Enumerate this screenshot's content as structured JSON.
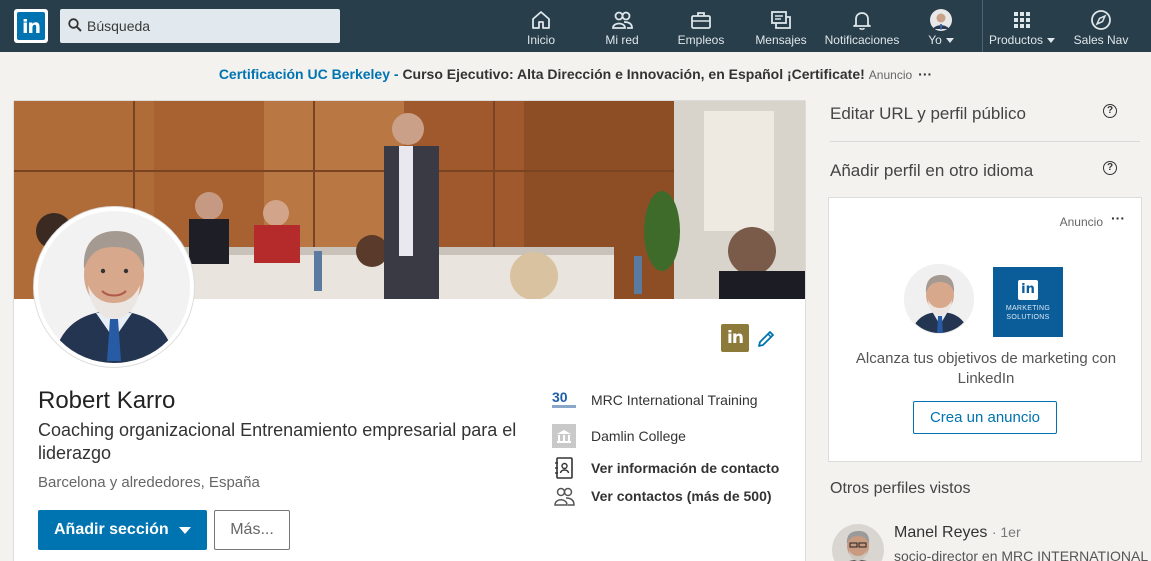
{
  "nav": {
    "logo": "in",
    "search_placeholder": "Búsqueda",
    "items": [
      {
        "label": "Inicio",
        "icon": "home-icon"
      },
      {
        "label": "Mi red",
        "icon": "network-icon"
      },
      {
        "label": "Empleos",
        "icon": "briefcase-icon"
      },
      {
        "label": "Mensajes",
        "icon": "messages-icon"
      },
      {
        "label": "Notificaciones",
        "icon": "bell-icon"
      },
      {
        "label": "Yo",
        "icon": "avatar"
      },
      {
        "label": "Productos",
        "icon": "grid-icon"
      },
      {
        "label": "Sales Nav",
        "icon": "compass-icon"
      }
    ]
  },
  "ad_bar": {
    "link": "Certificación UC Berkeley - ",
    "text": "Curso Ejecutivo: Alta Dirección e Innovación, en Español ¡Certificate!",
    "label": "Anuncio",
    "dots": "···"
  },
  "profile": {
    "badge": "in",
    "name": "Robert Karro",
    "headline": "Coaching organizacional Entrenamiento empresarial para el liderazgo",
    "location": "Barcelona y alrededores, España",
    "primary_button": "Añadir sección",
    "more_button": "Más...",
    "side": {
      "company": "MRC International Training",
      "education": "Damlin College",
      "contact": "Ver información de contacto",
      "connections": "Ver contactos (más de 500)"
    }
  },
  "rail": {
    "edit_url": "Editar URL y perfil público",
    "add_language": "Añadir perfil en otro idioma",
    "help": "?",
    "ad": {
      "label": "Anuncio",
      "dots": "···",
      "logo_text": "MARKETING SOLUTIONS",
      "logo_in": "in",
      "text": "Alcanza tus objetivos de marketing con LinkedIn",
      "button": "Crea un anuncio"
    },
    "others_title": "Otros perfiles vistos",
    "person": {
      "name": "Manel Reyes",
      "degree": "· 1er",
      "description": "socio-director en MRC INTERNATIONAL"
    }
  },
  "colors": {
    "nav_bg": "#283e4a",
    "brand_blue": "#0073b1",
    "page_bg": "#f3f2ef"
  }
}
